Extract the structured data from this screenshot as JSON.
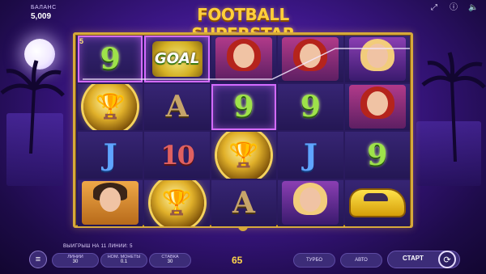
{
  "header": {
    "balance_label": "БАЛАНС",
    "balance_value": "5,009",
    "title": "FOOTBALL SUPERSTAR"
  },
  "top_icons": [
    "fullscreen-icon",
    "info-icon",
    "sound-icon"
  ],
  "reels": {
    "line_number": "5",
    "grid": [
      [
        "9",
        "GOAL",
        "woman-red",
        "woman-red",
        "woman-blonde"
      ],
      [
        "trophy",
        "A",
        "9",
        "9",
        "woman-red"
      ],
      [
        "J",
        "10",
        "trophy",
        "J",
        "9"
      ],
      [
        "man",
        "trophy",
        "A",
        "woman-blonde",
        "car"
      ]
    ]
  },
  "footer": {
    "win_message": "ВЫИГРЫШ НА 11 ЛИНИИ: 5",
    "lines_label": "ЛИНИИ",
    "lines_value": "30",
    "coin_label": "НОМ. МОНЕТЫ",
    "coin_value": "0.1",
    "bet_label": "СТАВКА",
    "bet_value": "30",
    "win_amount": "65",
    "turbo_label": "ТУРБО",
    "auto_label": "АВТО",
    "start_label": "СТАРТ"
  },
  "colors": {
    "gold": "#d6a93b",
    "win_highlight": "#d46bff",
    "background": "#3b1685"
  }
}
